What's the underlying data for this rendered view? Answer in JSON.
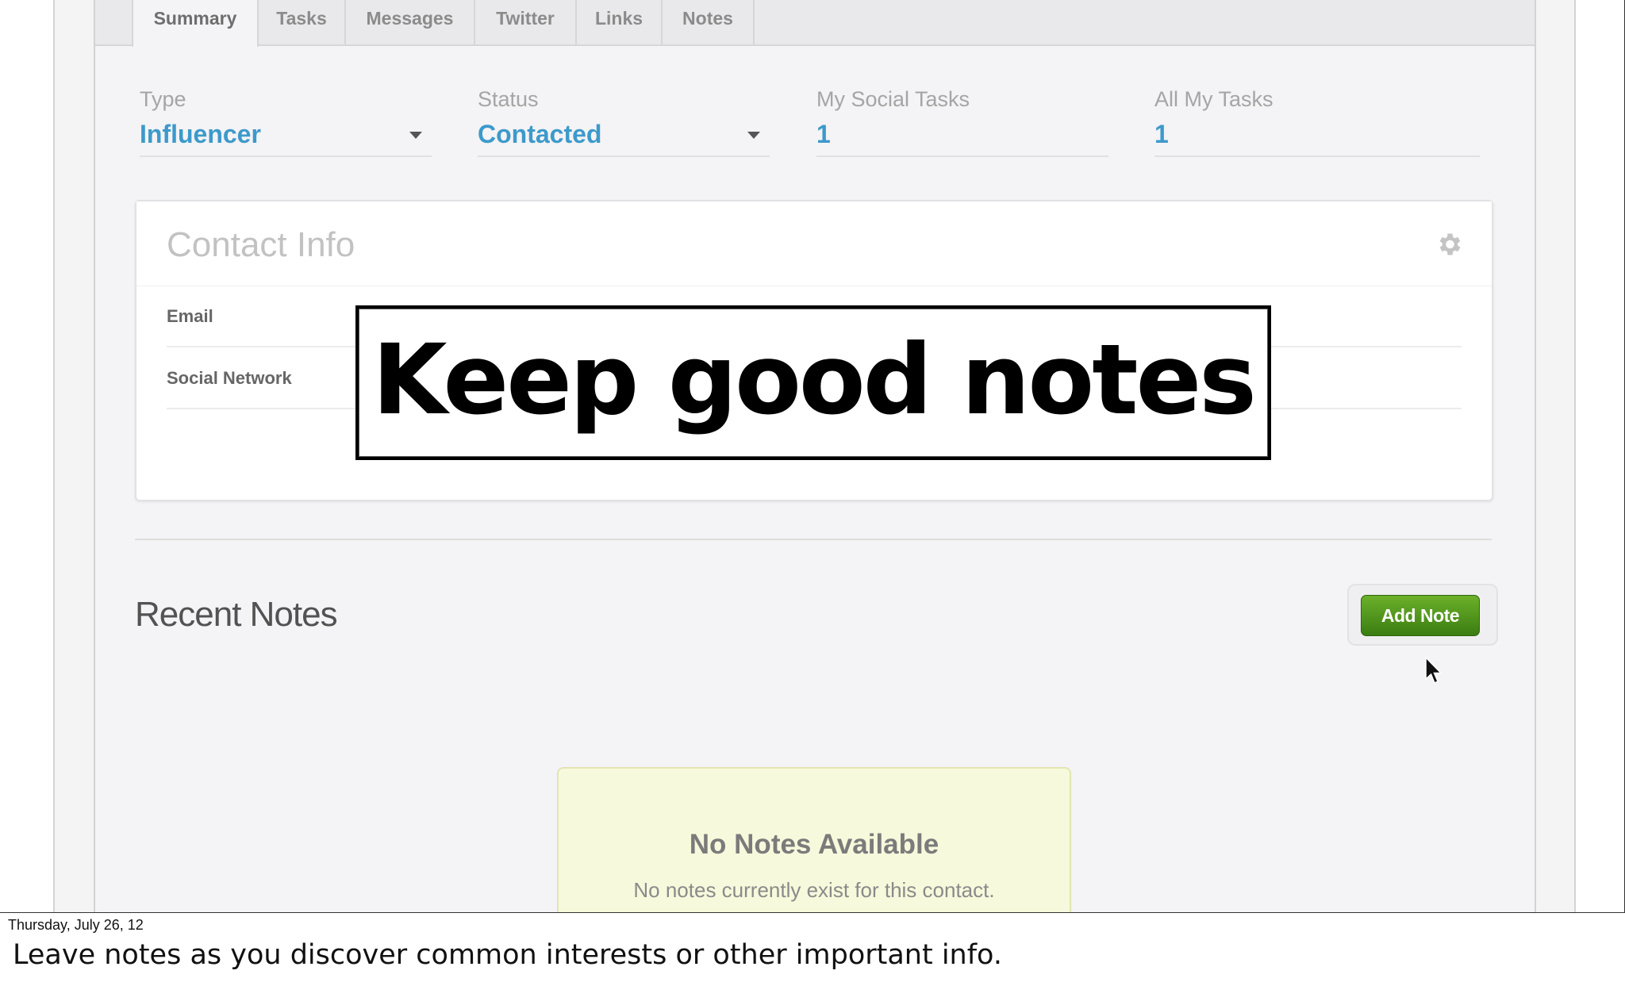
{
  "tabs": [
    "Summary",
    "Tasks",
    "Messages",
    "Twitter",
    "Links",
    "Notes"
  ],
  "fields": {
    "type": {
      "label": "Type",
      "value": "Influencer"
    },
    "status": {
      "label": "Status",
      "value": "Contacted"
    },
    "my_social_tasks": {
      "label": "My Social Tasks",
      "value": "1"
    },
    "all_my_tasks": {
      "label": "All My Tasks",
      "value": "1"
    }
  },
  "contact_info": {
    "title": "Contact Info",
    "rows": [
      "Email",
      "Social Network"
    ]
  },
  "recent_notes": {
    "title": "Recent Notes",
    "add_button": "Add Note",
    "empty_title": "No Notes Available",
    "empty_subtitle": "No notes currently exist for this contact."
  },
  "overlay": {
    "text": "Keep good notes"
  },
  "footer": {
    "date": "Thursday, July 26, 12",
    "note": "Leave notes as you discover common interests or other important info."
  },
  "colors": {
    "accent": "#3c9acb",
    "button_green": "#4f9a1c",
    "empty_bg": "#f7f9dc"
  },
  "icons": {
    "settings": "gear-icon",
    "dropdown": "chevron-down-icon",
    "pointer": "cursor-icon"
  }
}
